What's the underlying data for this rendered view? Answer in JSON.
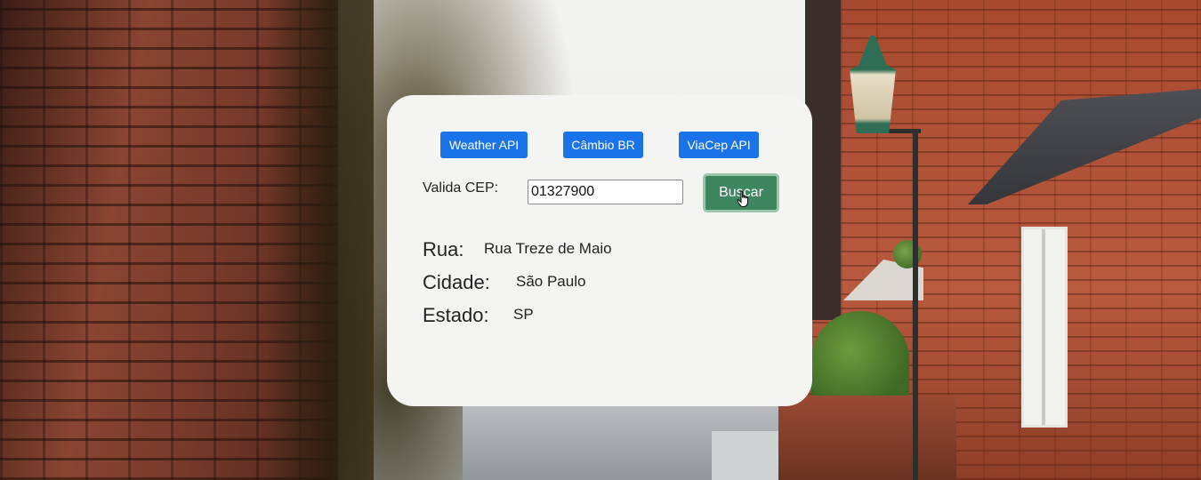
{
  "nav": {
    "weather_label": "Weather API",
    "cambio_label": "Câmbio BR",
    "viacep_label": "ViaCep API"
  },
  "cep": {
    "label": "Valida CEP:",
    "value": "01327900",
    "search_label": "Buscar"
  },
  "result": {
    "rua_label": "Rua:",
    "rua_value": "Rua Treze de Maio",
    "cidade_label": "Cidade:",
    "cidade_value": "São Paulo",
    "estado_label": "Estado:",
    "estado_value": "SP"
  },
  "colors": {
    "nav_button": "#1a73e8",
    "search_button": "#3d8660",
    "card_background": "#f4f4f2"
  },
  "icons": {
    "cursor": "hand-pointer-icon"
  }
}
